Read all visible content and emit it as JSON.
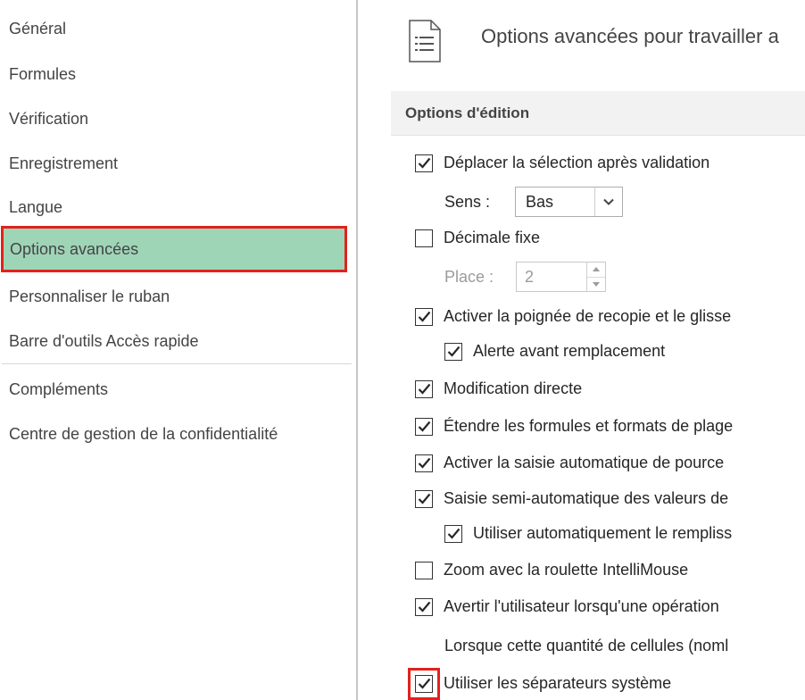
{
  "sidebar": {
    "items": [
      {
        "label": "Général"
      },
      {
        "label": "Formules"
      },
      {
        "label": "Vérification"
      },
      {
        "label": "Enregistrement"
      },
      {
        "label": "Langue"
      },
      {
        "label": "Options avancées",
        "selected": true
      },
      {
        "label": "Personnaliser le ruban"
      },
      {
        "label": "Barre d'outils Accès rapide"
      },
      {
        "label": "Compléments"
      },
      {
        "label": "Centre de gestion de la confidentialité"
      }
    ]
  },
  "main": {
    "icon": "document-lines-icon",
    "heading": "Options avancées pour travailler a",
    "section": {
      "title": "Options d'édition"
    },
    "options": {
      "move_selection": {
        "label": "Déplacer la sélection après validation",
        "checked": true
      },
      "direction": {
        "label": "Sens :",
        "value": "Bas"
      },
      "fixed_decimal": {
        "label": "Décimale fixe",
        "checked": false
      },
      "places": {
        "label": "Place :",
        "value": "2"
      },
      "fill_handle": {
        "label": "Activer la poignée de recopie et le glisse",
        "checked": true
      },
      "alert_overwrite": {
        "label": "Alerte avant remplacement",
        "checked": true
      },
      "edit_in_cell": {
        "label": "Modification directe",
        "checked": true
      },
      "extend_formats": {
        "label": "Étendre les formules et formats de plage",
        "checked": true
      },
      "auto_percent": {
        "label": "Activer la saisie automatique de pource",
        "checked": true
      },
      "autocomplete": {
        "label": "Saisie semi-automatique des valeurs de",
        "checked": true
      },
      "flash_fill": {
        "label": "Utiliser automatiquement le rempliss",
        "checked": true
      },
      "zoom_roll": {
        "label": "Zoom avec la roulette IntelliMouse",
        "checked": false
      },
      "alert_slow": {
        "label": "Avertir l'utilisateur lorsqu'une opération",
        "checked": true
      },
      "cells_threshold": {
        "label": "Lorsque cette quantité de cellules (noml"
      },
      "system_separators": {
        "label": "Utiliser les séparateurs système",
        "checked": true
      }
    }
  },
  "colors": {
    "selected_bg": "#9fd5b7",
    "highlight_border": "#e2211c",
    "section_bg": "#f2f2f2"
  }
}
